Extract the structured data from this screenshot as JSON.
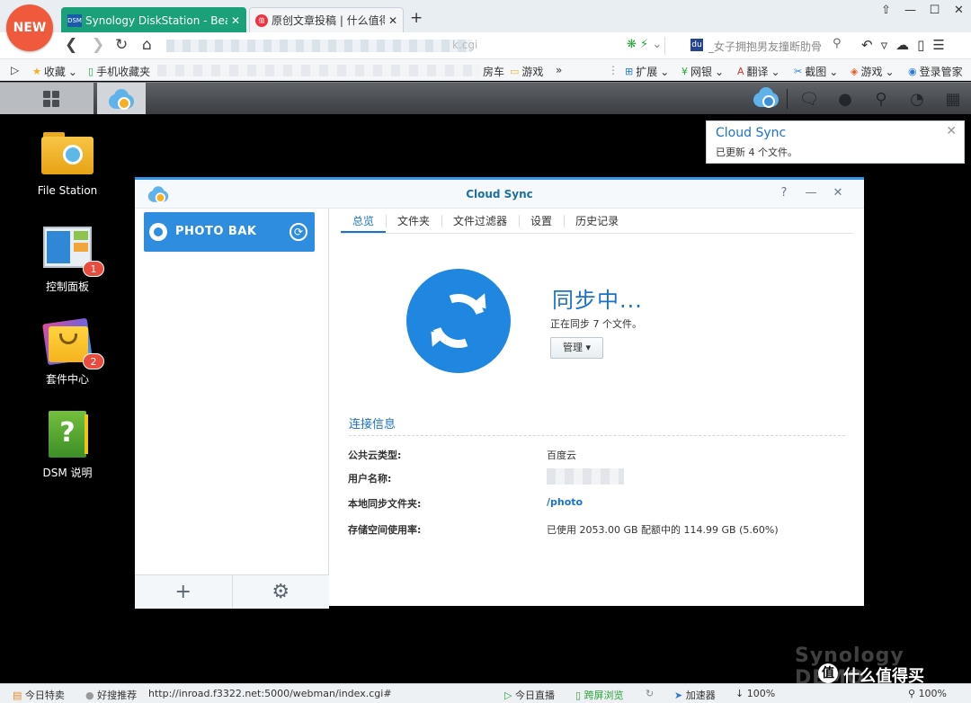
{
  "browser": {
    "new_badge": "NEW",
    "tabs": [
      {
        "icon_text": "DSM",
        "label": "Synology DiskStation - BearDi",
        "close": "✕"
      },
      {
        "icon_text": "值",
        "label": "原创文章投稿 | 什么值得买",
        "close": "✕"
      }
    ],
    "new_tab": "+",
    "window_controls": [
      "⇧",
      "—",
      "☐",
      "✕"
    ],
    "address": {
      "url_suffix": "k.cgi",
      "search_text": "_女子拥抱男友撞断肋骨",
      "search_logo": "du"
    },
    "bookmarks": [
      {
        "icon": "star-icon",
        "glyph": "★",
        "label": "收藏",
        "arrow": "⌄"
      },
      {
        "icon": "mobile-icon",
        "glyph": "▯",
        "label": "手机收藏夹"
      },
      {
        "icon": "partial",
        "glyph": "",
        "label": "房车"
      },
      {
        "icon": "folder-icon",
        "glyph": "▭",
        "label": "游戏"
      },
      {
        "icon": "more-icon",
        "glyph": "»",
        "label": ""
      },
      {
        "icon": "extension-icon",
        "glyph": "⊞",
        "label": "扩展",
        "arrow": "⌄"
      },
      {
        "icon": "bank-icon",
        "glyph": "¥",
        "label": "网银",
        "arrow": "⌄"
      },
      {
        "icon": "translate-icon",
        "glyph": "A",
        "label": "翻译",
        "arrow": "⌄"
      },
      {
        "icon": "screenshot-icon",
        "glyph": "✂",
        "label": "截图",
        "arrow": "⌄"
      },
      {
        "icon": "game-icon",
        "glyph": "◈",
        "label": "游戏",
        "arrow": "⌄"
      },
      {
        "icon": "user-icon",
        "glyph": "◉",
        "label": "登录管家"
      }
    ]
  },
  "desktop": {
    "icons": [
      {
        "label": "File Station"
      },
      {
        "label": "控制面板",
        "badge": "1"
      },
      {
        "label": "套件中心",
        "badge": "2"
      },
      {
        "label": "DSM 说明"
      }
    ]
  },
  "notification": {
    "title": "Cloud Sync",
    "message": "已更新 4 个文件。",
    "close": "✕"
  },
  "window": {
    "title": "Cloud Sync",
    "controls": [
      "?",
      "—",
      "✕"
    ],
    "task": {
      "name": "PHOTO BAK",
      "status_glyph": "⟳"
    },
    "footer": {
      "add": "+",
      "settings": "⚙"
    },
    "tabs": [
      "总览",
      "文件夹",
      "文件过滤器",
      "设置",
      "历史记录"
    ],
    "status_title": "同步中...",
    "status_sub": "正在同步 7 个文件。",
    "manage_label": "管理 ▾",
    "connection_title": "连接信息",
    "rows": [
      {
        "key": "公共云类型:",
        "value": "百度云"
      },
      {
        "key": "用户名称:",
        "value": ""
      },
      {
        "key": "本地同步文件夹:",
        "value": "/photo"
      },
      {
        "key": "存储空间使用率:",
        "value": "已使用 2053.00 GB 配额中的 114.99 GB (5.60%)"
      }
    ]
  },
  "statusbar": {
    "today_deals": "今日特卖",
    "recommend": "好搜推荐",
    "url": "http://inroad.f3322.net:5000/webman/index.cgi#",
    "live": "今日直播",
    "guard": "跨屏浏览",
    "accelerator": "加速器",
    "zoom_left": "100%",
    "zoom_right": "100%"
  },
  "watermark": "Synology DEMO",
  "zdm_logo": "什么值得买",
  "zdm_mark": "值"
}
